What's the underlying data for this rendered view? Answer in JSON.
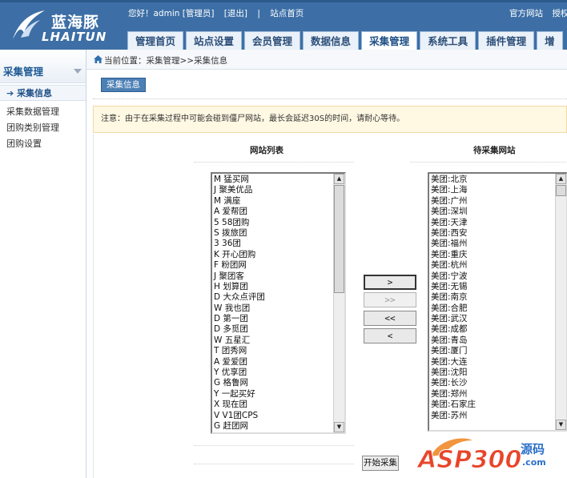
{
  "brand": {
    "name_cn": "蓝海豚",
    "name_en": "LHAITUN"
  },
  "topbar": {
    "greeting": "您好！admin [管理员]",
    "logout": "[退出]",
    "site_home": "站点首页",
    "official_site": "官方网站",
    "license": "授权"
  },
  "nav": {
    "tabs": [
      {
        "label": "管理首页"
      },
      {
        "label": "站点设置"
      },
      {
        "label": "会员管理"
      },
      {
        "label": "数据信息"
      },
      {
        "label": "采集管理"
      },
      {
        "label": "系统工具"
      },
      {
        "label": "插件管理"
      },
      {
        "label": "增"
      }
    ],
    "active": "采集管理"
  },
  "sidebar": {
    "title": "采集管理",
    "items": [
      {
        "label": "采集信息"
      },
      {
        "label": "采集数据管理"
      },
      {
        "label": "团购类别管理"
      },
      {
        "label": "团购设置"
      }
    ]
  },
  "breadcrumb": {
    "text": "当前位置：采集管理>>采集信息"
  },
  "subtab": {
    "label": "采集信息"
  },
  "notice": {
    "text": "注意：由于在采集过程中可能会碰到僵尸网站，最长会延迟30S的时间，请耐心等待。"
  },
  "site_list": {
    "title": "网站列表",
    "items": [
      "M 猛买网",
      "J 聚美优品",
      "M 满座",
      "A 爱帮团",
      "5 58团购",
      "S 拨旅团",
      "3 36团",
      "K 开心团购",
      "F 粉团网",
      "J 聚团客",
      "H 划算团",
      "D 大众点评团",
      "W 我也团",
      "D 第一团",
      "D 多觅团",
      "W 五星汇",
      "T 团秀网",
      "A 爱爱团",
      "Y 优享团",
      "G 格鲁网",
      "Y 一起买好",
      "X 现在团",
      "V V1团CPS",
      "G 赶团网"
    ]
  },
  "pending_list": {
    "title": "待采集网站",
    "items": [
      "美团:北京",
      "美团:上海",
      "美团:广州",
      "美团:深圳",
      "美团:天津",
      "美团:西安",
      "美团:福州",
      "美团:重庆",
      "美团:杭州",
      "美团:宁波",
      "美团:无锡",
      "美团:南京",
      "美团:合肥",
      "美团:武汉",
      "美团:成都",
      "美团:青岛",
      "美团:厦门",
      "美团:大连",
      "美团:沈阳",
      "美团:长沙",
      "美团:郑州",
      "美团:石家庄",
      "美团:苏州"
    ]
  },
  "transfer_buttons": {
    "add": ">",
    "add_all": ">>",
    "remove_all": "<<",
    "remove": "<"
  },
  "start_button": {
    "label": "开始采集"
  },
  "watermark": {
    "text": "ASP300",
    "suffix_cn": "源码",
    "domain": ".com"
  },
  "colors": {
    "header_bg": "#3d6fa6",
    "accent": "#1e5a96",
    "notice_bg": "#fff8e3"
  },
  "icons": {
    "home": "home-icon",
    "logo": "dolphin-logo-icon"
  }
}
